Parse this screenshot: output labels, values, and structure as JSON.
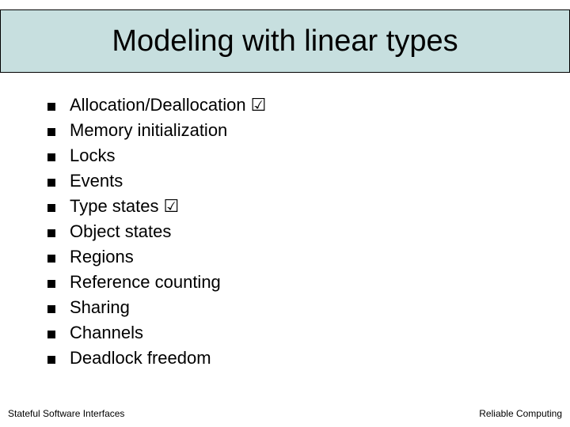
{
  "title": "Modeling with linear types",
  "items": [
    {
      "label": "Allocation/Deallocation",
      "checked": true
    },
    {
      "label": "Memory initialization",
      "checked": false
    },
    {
      "label": "Locks",
      "checked": false
    },
    {
      "label": "Events",
      "checked": false
    },
    {
      "label": "Type states",
      "checked": true
    },
    {
      "label": "Object states",
      "checked": false
    },
    {
      "label": "Regions",
      "checked": false
    },
    {
      "label": "Reference counting",
      "checked": false
    },
    {
      "label": "Sharing",
      "checked": false
    },
    {
      "label": "Channels",
      "checked": false
    },
    {
      "label": "Deadlock freedom",
      "checked": false
    }
  ],
  "footer": {
    "left": "Stateful Software Interfaces",
    "right": "Reliable Computing"
  },
  "check_glyph": "☑"
}
